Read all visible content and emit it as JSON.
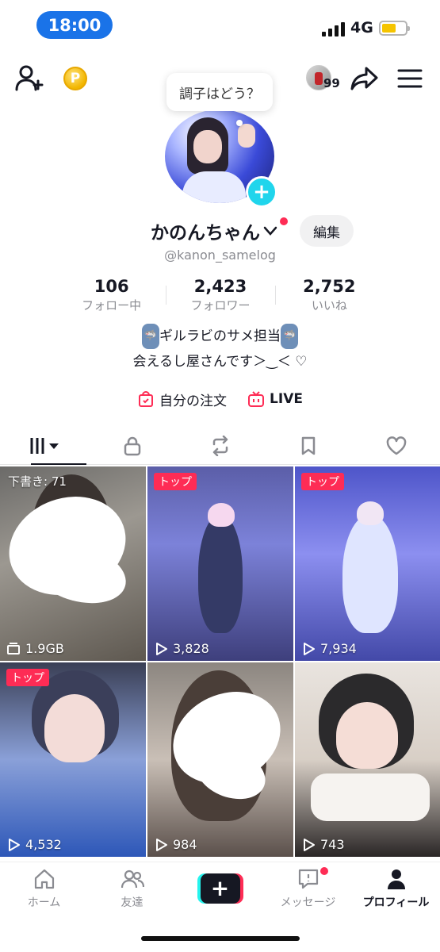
{
  "status_bar": {
    "time": "18:00",
    "network": "4G",
    "battery_color": "#f5c400",
    "time_pill_color": "#1a73e8"
  },
  "top_bar": {
    "coin_symbol": "P",
    "visitor_count": "99"
  },
  "profile": {
    "status_bubble": "調子はどう？",
    "name": "かのんちゃん",
    "edit_label": "編集",
    "handle": "@kanon_samelog",
    "stats": [
      {
        "value": "106",
        "label": "フォロー中"
      },
      {
        "value": "2,423",
        "label": "フォロワー"
      },
      {
        "value": "2,752",
        "label": "いいね"
      }
    ],
    "bio_line1": "ギルラビのサメ担当",
    "bio_line2": "会えるし屋さんです＞‿＜ ♡",
    "shark_icon": "🦈"
  },
  "links": {
    "orders": "自分の注文",
    "live": "LIVE"
  },
  "tabs": [
    "grid-tab",
    "private-tab",
    "repost-tab",
    "favorites-tab",
    "liked-tab"
  ],
  "videos": [
    {
      "draft_label": "下書き: 71",
      "meta": "1.9GB"
    },
    {
      "tag": "トップ",
      "views": "3,828"
    },
    {
      "tag": "トップ",
      "views": "7,934"
    },
    {
      "tag": "トップ",
      "views": "4,532"
    },
    {
      "views": "984"
    },
    {
      "views": "743"
    }
  ],
  "bottom_nav": {
    "home": "ホーム",
    "friends": "友達",
    "create": "+",
    "inbox": "メッセージ",
    "profile": "プロフィール"
  },
  "colors": {
    "accent": "#fe2c55",
    "cyan": "#25f4ee",
    "badge": "#20d5ec",
    "text": "#161823",
    "muted": "#8a8b91"
  }
}
